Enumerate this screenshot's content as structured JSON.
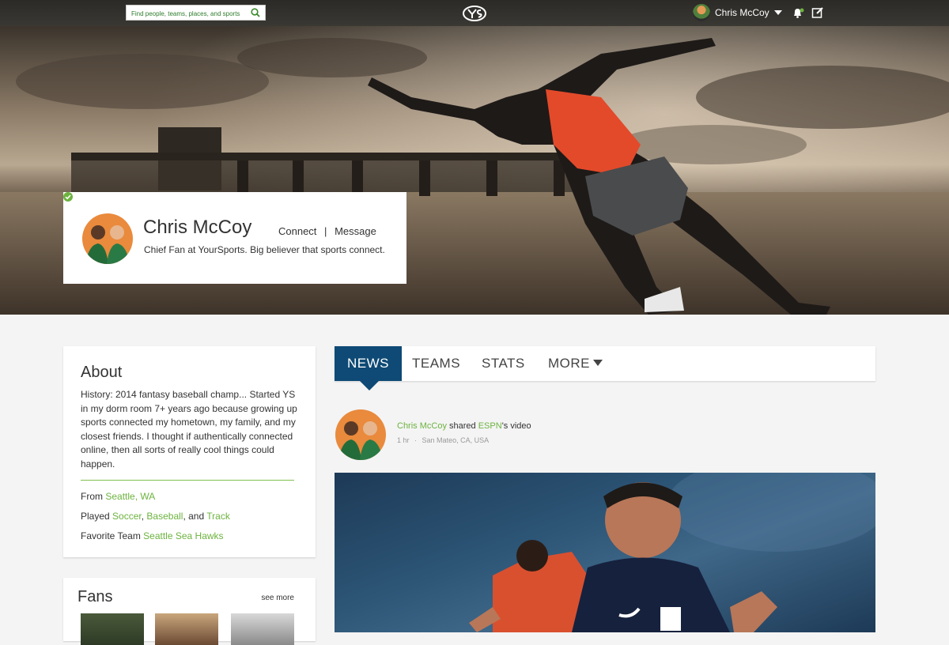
{
  "topbar": {
    "search_placeholder": "Find people, teams, places, and sports",
    "user_name": "Chris McCoy"
  },
  "profile": {
    "name": "Chris McCoy",
    "connect_label": "Connect",
    "separator": "|",
    "message_label": "Message",
    "bio": "Chief Fan at YourSports. Big believer that sports connect."
  },
  "about": {
    "title": "About",
    "history": "History: 2014 fantasy baseball champ... Started YS in my dorm room 7+ years ago because growing up sports connected my hometown, my family, and my closest friends. I thought if authentically connected online, then all sorts of really cool things could happen.",
    "from_label": "From",
    "from_value": "Seattle, WA",
    "played_label": "Played",
    "sport1": "Soccer",
    "comma": ",",
    "sport2": "Baseball",
    "and_text": ", and",
    "sport3": "Track",
    "team_label": "Favorite Team",
    "team_value": "Seattle Sea Hawks"
  },
  "fans": {
    "title": "Fans",
    "see_more": "see more"
  },
  "tabs": [
    {
      "label": "NEWS"
    },
    {
      "label": "TEAMS"
    },
    {
      "label": "STATS"
    },
    {
      "label": "MORE"
    }
  ],
  "post": {
    "author": "Chris McCoy",
    "action": "shared",
    "source": "ESPN",
    "suffix": "'s video",
    "time": "1 hr",
    "dot": "·",
    "location": "San Mateo, CA, USA"
  },
  "colors": {
    "accent_green": "#6db33f",
    "tab_active": "#0e4a75",
    "topbar": "#2b2a27"
  }
}
